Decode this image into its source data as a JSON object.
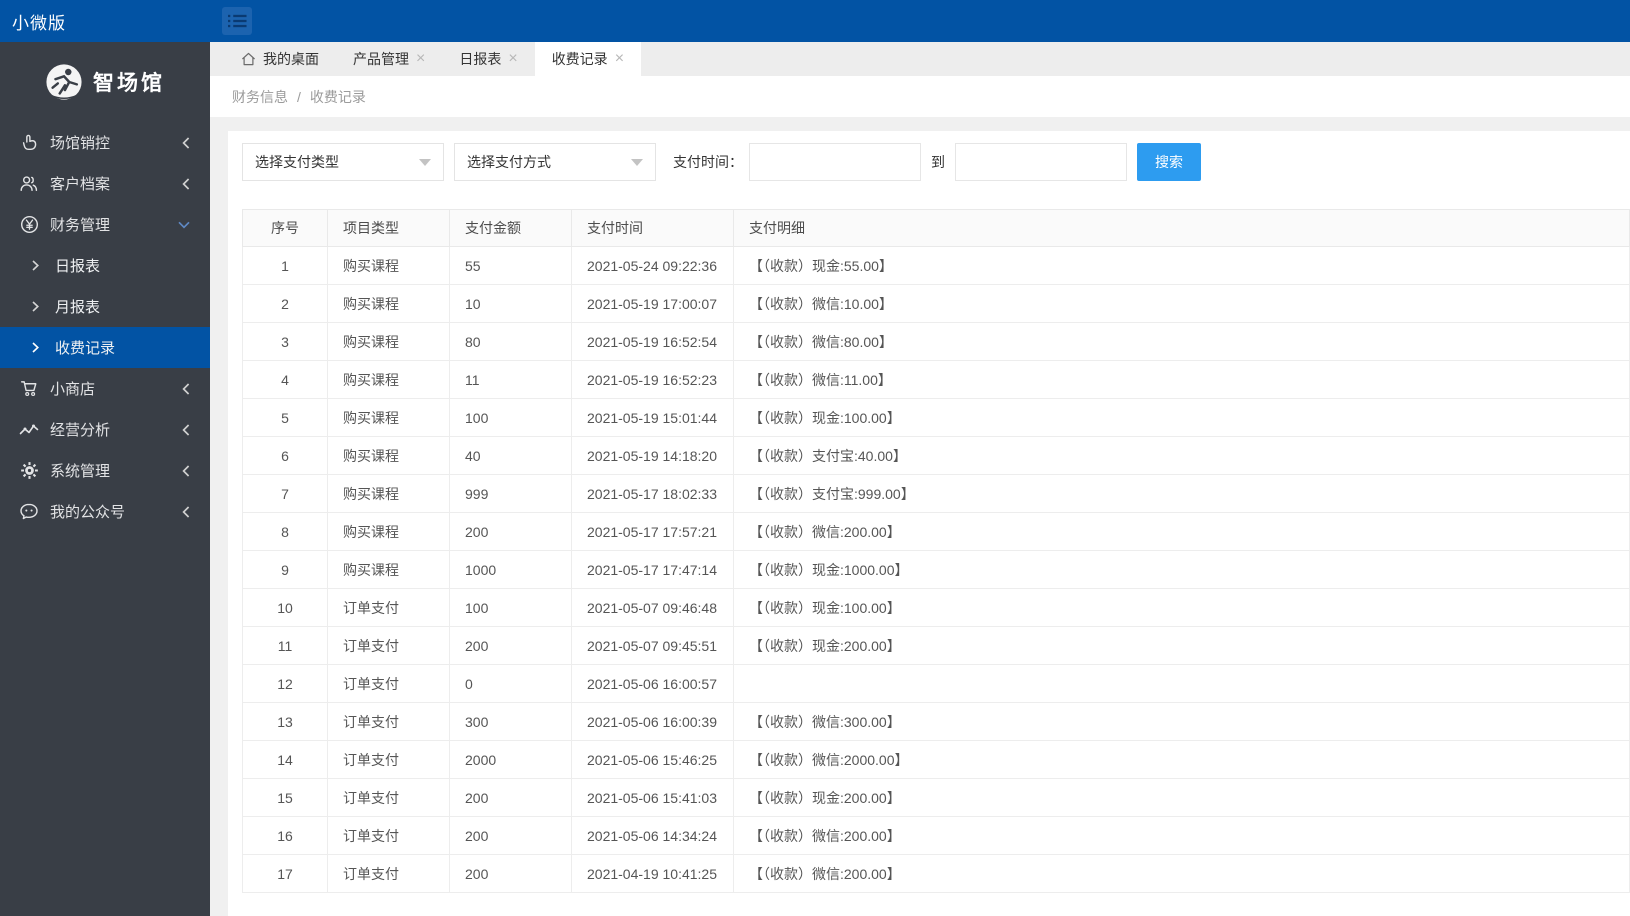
{
  "header": {
    "brand": "小微版"
  },
  "sidebar": {
    "logo_text": "智场馆",
    "items": [
      {
        "label": "场馆销控",
        "icon": "venue-sales-icon",
        "state": "collapsed"
      },
      {
        "label": "客户档案",
        "icon": "customer-files-icon",
        "state": "collapsed"
      },
      {
        "label": "财务管理",
        "icon": "finance-icon",
        "state": "expanded",
        "children": [
          {
            "label": "日报表",
            "active": false
          },
          {
            "label": "月报表",
            "active": false
          },
          {
            "label": "收费记录",
            "active": true
          }
        ]
      },
      {
        "label": "小商店",
        "icon": "shop-icon",
        "state": "collapsed"
      },
      {
        "label": "经营分析",
        "icon": "analytics-icon",
        "state": "collapsed"
      },
      {
        "label": "系统管理",
        "icon": "settings-icon",
        "state": "collapsed"
      },
      {
        "label": "我的公众号",
        "icon": "wechat-icon",
        "state": "collapsed"
      }
    ]
  },
  "tabs": [
    {
      "label": "我的桌面",
      "icon": "home-icon",
      "closable": false,
      "active": false
    },
    {
      "label": "产品管理",
      "closable": true,
      "active": false
    },
    {
      "label": "日报表",
      "closable": true,
      "active": false
    },
    {
      "label": "收费记录",
      "closable": true,
      "active": true
    }
  ],
  "close_glyph": "×",
  "breadcrumb": {
    "section": "财务信息",
    "separator": "/",
    "current": "收费记录"
  },
  "filters": {
    "pay_type_select": "选择支付类型",
    "pay_method_select": "选择支付方式",
    "time_label": "支付时间：",
    "from_value": "",
    "to_label": "到",
    "to_value": "",
    "search_button": "搜索"
  },
  "table": {
    "columns": [
      "序号",
      "项目类型",
      "支付金额",
      "支付时间",
      "支付明细"
    ],
    "rows": [
      [
        "1",
        "购买课程",
        "55",
        "2021-05-24 09:22:36",
        "【（收款）现金:55.00】"
      ],
      [
        "2",
        "购买课程",
        "10",
        "2021-05-19 17:00:07",
        "【（收款）微信:10.00】"
      ],
      [
        "3",
        "购买课程",
        "80",
        "2021-05-19 16:52:54",
        "【（收款）微信:80.00】"
      ],
      [
        "4",
        "购买课程",
        "11",
        "2021-05-19 16:52:23",
        "【（收款）微信:11.00】"
      ],
      [
        "5",
        "购买课程",
        "100",
        "2021-05-19 15:01:44",
        "【（收款）现金:100.00】"
      ],
      [
        "6",
        "购买课程",
        "40",
        "2021-05-19 14:18:20",
        "【（收款）支付宝:40.00】"
      ],
      [
        "7",
        "购买课程",
        "999",
        "2021-05-17 18:02:33",
        "【（收款）支付宝:999.00】"
      ],
      [
        "8",
        "购买课程",
        "200",
        "2021-05-17 17:57:21",
        "【（收款）微信:200.00】"
      ],
      [
        "9",
        "购买课程",
        "1000",
        "2021-05-17 17:47:14",
        "【（收款）现金:1000.00】"
      ],
      [
        "10",
        "订单支付",
        "100",
        "2021-05-07 09:46:48",
        "【（收款）现金:100.00】"
      ],
      [
        "11",
        "订单支付",
        "200",
        "2021-05-07 09:45:51",
        "【（收款）现金:200.00】"
      ],
      [
        "12",
        "订单支付",
        "0",
        "2021-05-06 16:00:57",
        ""
      ],
      [
        "13",
        "订单支付",
        "300",
        "2021-05-06 16:00:39",
        "【（收款）微信:300.00】"
      ],
      [
        "14",
        "订单支付",
        "2000",
        "2021-05-06 15:46:25",
        "【（收款）微信:2000.00】"
      ],
      [
        "15",
        "订单支付",
        "200",
        "2021-05-06 15:41:03",
        "【（收款）现金:200.00】"
      ],
      [
        "16",
        "订单支付",
        "200",
        "2021-05-06 14:34:24",
        "【（收款）微信:200.00】"
      ],
      [
        "17",
        "订单支付",
        "200",
        "2021-04-19 10:41:25",
        "【（收款）微信:200.00】"
      ]
    ]
  },
  "colors": {
    "brand_blue": "#0253a4",
    "sidebar_dark": "#393e46",
    "active_item_blue": "#0253a4",
    "search_button_blue": "#2d9cf0",
    "tabbar_gray": "#ededed",
    "table_header_bg": "#fafafa"
  }
}
